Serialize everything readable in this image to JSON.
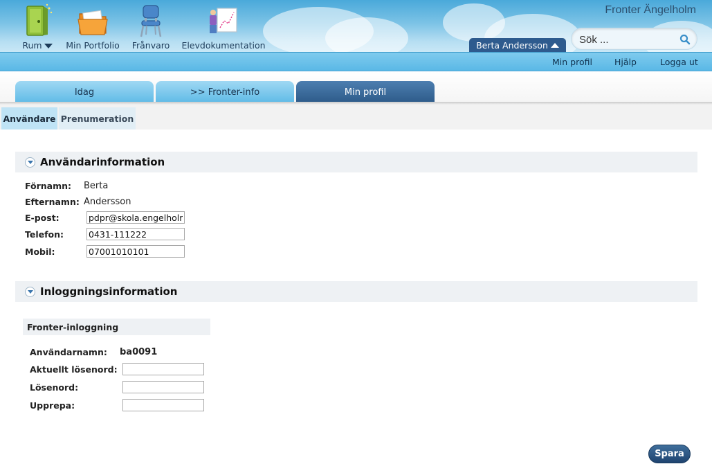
{
  "header": {
    "org_name": "Fronter Ängelholm",
    "nav": [
      {
        "label": "Rum",
        "icon": "door-icon"
      },
      {
        "label": "Min Portfolio",
        "icon": "folder-icon"
      },
      {
        "label": "Frånvaro",
        "icon": "chair-icon"
      },
      {
        "label": "Elevdokumentation",
        "icon": "chart-presentation-icon"
      }
    ],
    "user_name": "Berta Andersson",
    "search_placeholder": "Sök ..."
  },
  "topbar": {
    "links": [
      "Min profil",
      "Hjälp",
      "Logga ut"
    ]
  },
  "tabs": {
    "items": [
      "Idag",
      ">> Fronter-info",
      "Min profil"
    ],
    "active": "Min profil"
  },
  "subtabs": {
    "items": [
      "Användare",
      "Prenumeration"
    ],
    "active": "Användare"
  },
  "user_info": {
    "title": "Användarinformation",
    "firstname_label": "Förnamn:",
    "firstname": "Berta",
    "lastname_label": "Efternamn:",
    "lastname": "Andersson",
    "email_label": "E-post:",
    "email": "pdpr@skola.engelholm",
    "phone_label": "Telefon:",
    "phone": "0431-111222",
    "mobile_label": "Mobil:",
    "mobile": "07001010101"
  },
  "login_info": {
    "title": "Inloggningsinformation",
    "subtitle": "Fronter-inloggning",
    "username_label": "Användarnamn:",
    "username": "ba0091",
    "current_password_label": "Aktuellt lösenord:",
    "password_label": "Lösenord:",
    "repeat_label": "Upprepa:"
  },
  "actions": {
    "save_label": "Spara"
  },
  "colors": {
    "header_sky": "#4aa9da",
    "topbar": "#5ab8e6",
    "active_tab": "#2c5987",
    "subtab_active": "#bfe3f5",
    "save_button": "#1f4470"
  }
}
